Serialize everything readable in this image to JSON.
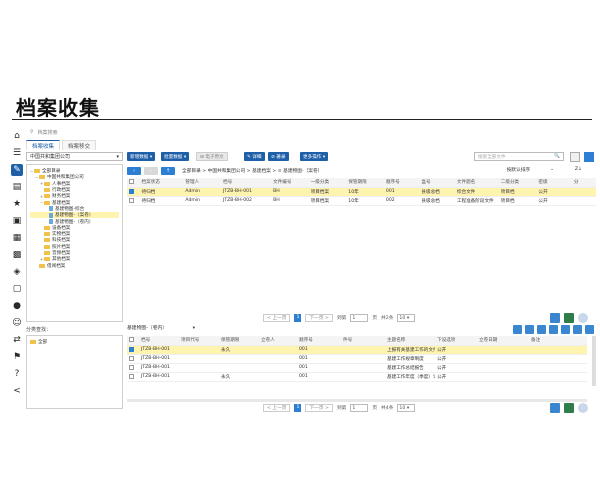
{
  "page": {
    "title": "档案收集"
  },
  "sidebar": {
    "icons": [
      "home-icon",
      "archive-icon",
      "edit-icon",
      "stats-icon",
      "star-icon",
      "file-icon",
      "gallery-icon",
      "lock-icon",
      "settings-icon",
      "book-icon",
      "chat-icon",
      "users-icon",
      "share-icon",
      "location-icon",
      "help-icon",
      "network-icon"
    ]
  },
  "breadcrumb": {
    "items": [
      "⚲",
      "档案搜索"
    ]
  },
  "tabs": [
    {
      "label": "档案收集"
    },
    {
      "label": "档案移交"
    }
  ],
  "tree": {
    "company_select": "中国共和集团公司",
    "nodes": [
      {
        "label": "全部目录",
        "level": 0,
        "type": "folder",
        "toggle": "−"
      },
      {
        "label": "中国共和集团公司",
        "level": 1,
        "type": "folder",
        "toggle": "−"
      },
      {
        "label": "人事档案",
        "level": 2,
        "type": "folder",
        "toggle": "+"
      },
      {
        "label": "行政档案",
        "level": 2,
        "type": "folder",
        "toggle": ""
      },
      {
        "label": "财务档案",
        "level": 2,
        "type": "folder",
        "toggle": "+"
      },
      {
        "label": "基建档案",
        "level": 2,
        "type": "folder",
        "toggle": "−"
      },
      {
        "label": "基建物图-综合",
        "level": 3,
        "type": "doc",
        "toggle": ""
      },
      {
        "label": "基建物图-（案卷）",
        "level": 3,
        "type": "doc",
        "toggle": "",
        "highlight": true
      },
      {
        "label": "基建物图-（卷内）",
        "level": 3,
        "type": "doc",
        "toggle": ""
      },
      {
        "label": "设备档案",
        "level": 2,
        "type": "folder",
        "toggle": ""
      },
      {
        "label": "实物档案",
        "level": 2,
        "type": "folder",
        "toggle": ""
      },
      {
        "label": "科技档案",
        "level": 2,
        "type": "folder",
        "toggle": ""
      },
      {
        "label": "照片档案",
        "level": 2,
        "type": "folder",
        "toggle": ""
      },
      {
        "label": "音频档案",
        "level": 2,
        "type": "folder",
        "toggle": ""
      },
      {
        "label": "其他档案",
        "level": 2,
        "type": "folder",
        "toggle": "+"
      },
      {
        "label": "借阅档案",
        "level": 1,
        "type": "folder",
        "toggle": ""
      }
    ],
    "category_label": "分类查找：",
    "category_node": "全部"
  },
  "toolbar": {
    "buttons": [
      {
        "label": "新增数据 ▾",
        "style": "primary"
      },
      {
        "label": "批量数据 ▾",
        "style": "primary"
      },
      {
        "label": "⊞ 电子原文",
        "style": "gray"
      },
      {
        "label": "✎ 详细",
        "style": "primary"
      },
      {
        "label": "⊘ 著录",
        "style": "primary"
      },
      {
        "label": "更多操作 ▾",
        "style": "primary"
      }
    ],
    "search_placeholder": "搜索全部文件",
    "search_icon": "🔍"
  },
  "path": {
    "text": "全部目录 > 中国共和集团公司 > 基建档案 > ≡ 基建物图-（案卷）",
    "sort_label": "按默认排序",
    "sort_arrow": "⌄",
    "sort2_label": "Z↓"
  },
  "upper_table": {
    "headers": [
      "",
      "档案状态",
      "管理人",
      "档号",
      "文件编号",
      "一级分类",
      "保管期限",
      "顺序号",
      "盒号",
      "文件题名",
      "二级分类",
      "密级",
      "分"
    ],
    "rows": [
      {
        "checked": true,
        "highlight": true,
        "cells": [
          "待归档",
          "Admin",
          "JTZB-BH-001",
          "BH",
          "项目档案",
          "10年",
          "001",
          "县级总档",
          "综合文件",
          "项目档",
          "公开",
          ""
        ]
      },
      {
        "checked": false,
        "highlight": false,
        "cells": [
          "待归档",
          "Admin",
          "JTZB-BH-002",
          "BH",
          "项目档案",
          "10年",
          "002",
          "县级总档",
          "工程准备阶段文件",
          "项目档",
          "公开",
          ""
        ]
      }
    ]
  },
  "upper_pager": {
    "prev": "< 上一页",
    "page": "1",
    "next": "下一页 >",
    "goto": "到第",
    "goto_value": "1",
    "page_unit": "页",
    "count": "共2条",
    "size": "10",
    "size_arrow": "▾"
  },
  "sub": {
    "title": "基建物图-（卷内）",
    "title_arrow": "▾",
    "headers": [
      "",
      "档号",
      "项目代号",
      "保管期限",
      "立卷人",
      "顺序号",
      "件号",
      "主题名称",
      "下设选项",
      "立卷日期",
      "备注"
    ],
    "rows": [
      {
        "checked": true,
        "highlight": true,
        "cells": [
          "JTZB-BH-001",
          "",
          "永久",
          "",
          "001",
          "",
          "上报有关基建工作的文件",
          "公开",
          "",
          ""
        ]
      },
      {
        "checked": false,
        "highlight": false,
        "cells": [
          "JTZB-BH-001",
          "",
          "",
          "",
          "001",
          "",
          "基建工作规章制度",
          "公开",
          "",
          ""
        ]
      },
      {
        "checked": false,
        "highlight": false,
        "cells": [
          "JTZB-BH-001",
          "",
          "",
          "",
          "001",
          "",
          "基建工作总结报告",
          "公开",
          "",
          ""
        ]
      },
      {
        "checked": false,
        "highlight": false,
        "cells": [
          "JTZB-BH-001",
          "",
          "永久",
          "",
          "001",
          "",
          "基建工作年度（季度）计划",
          "公开",
          "",
          ""
        ]
      }
    ]
  },
  "lower_pager": {
    "prev": "< 上一页",
    "page": "1",
    "next": "下一页 >",
    "goto": "到第",
    "goto_value": "1",
    "page_unit": "页",
    "count": "共4条",
    "size": "10",
    "size_arrow": "▾"
  },
  "colors": {
    "accent": "#1f5fa8",
    "highlight": "#fff3b0",
    "folder": "#f0c24a"
  }
}
